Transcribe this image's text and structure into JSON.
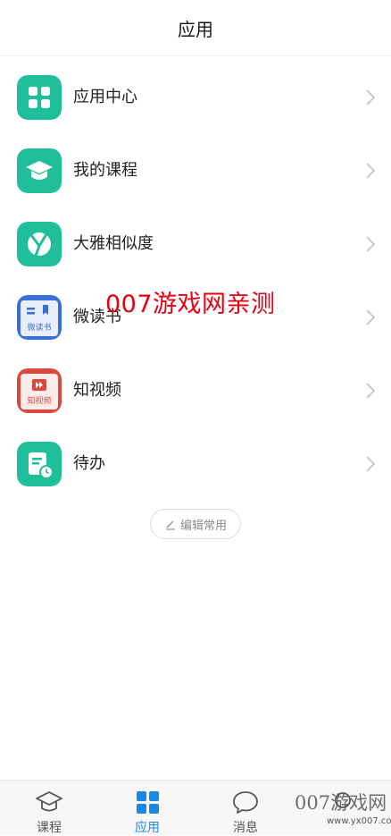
{
  "header": {
    "title": "应用"
  },
  "apps": [
    {
      "label": "应用中心",
      "icon": "grid-app-icon"
    },
    {
      "label": "我的课程",
      "icon": "graduation-cap-app-icon"
    },
    {
      "label": "大雅相似度",
      "icon": "daya-app-icon"
    },
    {
      "label": "微读书",
      "icon": "weidushu-app-icon",
      "icon_text": "微读书"
    },
    {
      "label": "知视频",
      "icon": "zhishipin-app-icon",
      "icon_text": "知视频"
    },
    {
      "label": "待办",
      "icon": "todo-app-icon"
    }
  ],
  "watermark": "007游戏网亲测",
  "edit_button": {
    "label": "编辑常用"
  },
  "tabs": [
    {
      "label": "课程",
      "icon": "graduation-cap-icon",
      "active": false
    },
    {
      "label": "应用",
      "icon": "grid-icon",
      "active": true
    },
    {
      "label": "消息",
      "icon": "chat-bubble-icon",
      "active": false
    }
  ],
  "corner_watermark": {
    "text": "007游戏网",
    "url": "www.yx007.com"
  },
  "colors": {
    "teal": "#1fbf9c",
    "active_blue": "#1a87e6",
    "red": "#e60012"
  }
}
